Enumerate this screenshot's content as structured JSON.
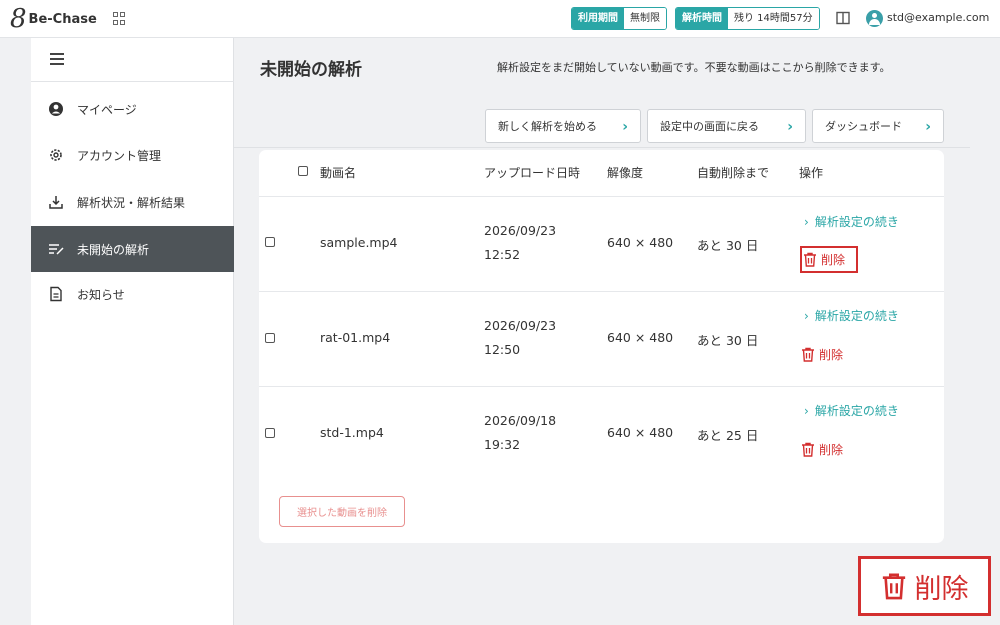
{
  "app": {
    "brand_mark": "8",
    "brand_name": "Be-Chase"
  },
  "header": {
    "period_label": "利用期間",
    "period_value": "無制限",
    "analysis_time_label": "解析時間",
    "analysis_time_value": "残り 14時間57分",
    "user_email": "std@example.com"
  },
  "sidebar": {
    "items": [
      {
        "label": "マイページ",
        "icon": "user-circle-icon"
      },
      {
        "label": "アカウント管理",
        "icon": "gear-icon"
      },
      {
        "label": "解析状況・解析結果",
        "icon": "download-icon"
      },
      {
        "label": "未開始の解析",
        "icon": "list-edit-icon",
        "active": true
      },
      {
        "label": "お知らせ",
        "icon": "document-icon"
      }
    ]
  },
  "main": {
    "title": "未開始の解析",
    "description": "解析設定をまだ開始していない動画です。不要な動画はここから削除できます。",
    "buttons": {
      "new_analysis": "新しく解析を始める",
      "back_to_setting": "設定中の画面に戻る",
      "dashboard": "ダッシュボード"
    }
  },
  "table": {
    "headers": [
      "動画名",
      "アップロード日時",
      "解像度",
      "自動削除まで",
      "操作"
    ],
    "rows": [
      {
        "name": "sample.mp4",
        "date": "2026/09/23",
        "time": "12:52",
        "resolution": "640 × 480",
        "auto_delete": "あと 30 日",
        "continue": "解析設定の続き",
        "delete": "削除"
      },
      {
        "name": "rat-01.mp4",
        "date": "2026/09/23",
        "time": "12:50",
        "resolution": "640 × 480",
        "auto_delete": "あと 30 日",
        "continue": "解析設定の続き",
        "delete": "削除"
      },
      {
        "name": "std-1.mp4",
        "date": "2026/09/18",
        "time": "19:32",
        "resolution": "640 × 480",
        "auto_delete": "あと 25 日",
        "continue": "解析設定の続き",
        "delete": "削除"
      }
    ],
    "bulk_delete": "選択した動画を削除"
  },
  "callout": {
    "label": "削除"
  },
  "colors": {
    "accent": "#2aa6a6",
    "danger": "#d32f2f",
    "sidebar_active": "#4e5458"
  }
}
